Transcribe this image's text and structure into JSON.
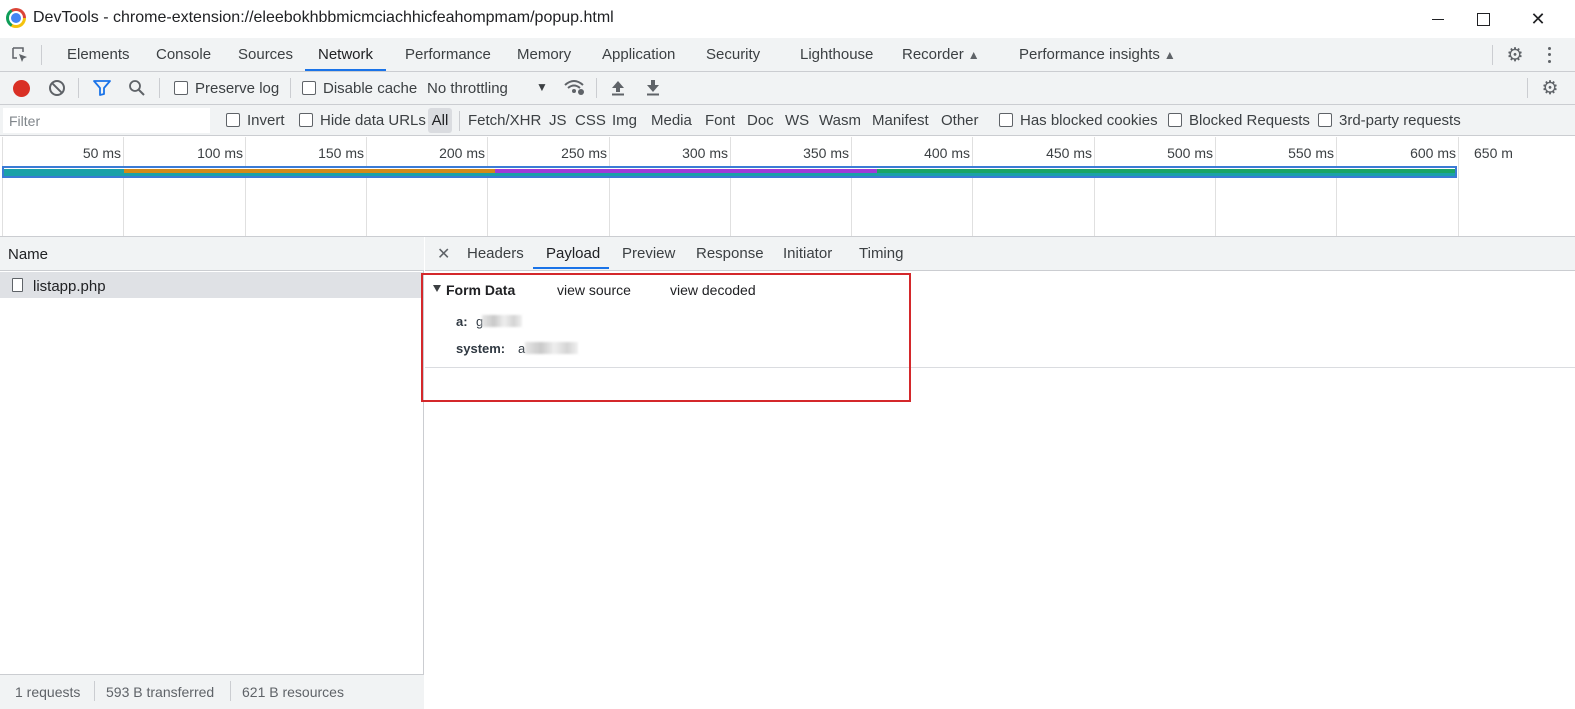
{
  "window": {
    "title": "DevTools - chrome-extension://eleebokhbbmicmciachhicfeahompmam/popup.html"
  },
  "main_tabs": [
    {
      "label": "Elements"
    },
    {
      "label": "Console"
    },
    {
      "label": "Sources"
    },
    {
      "label": "Network"
    },
    {
      "label": "Performance"
    },
    {
      "label": "Memory"
    },
    {
      "label": "Application"
    },
    {
      "label": "Security"
    },
    {
      "label": "Lighthouse"
    },
    {
      "label": "Recorder"
    },
    {
      "label": "Performance insights"
    }
  ],
  "active_main_tab": "Network",
  "toolbar": {
    "preserve_log": "Preserve log",
    "disable_cache": "Disable cache",
    "throttling": "No throttling"
  },
  "filter": {
    "placeholder": "Filter",
    "invert": "Invert",
    "hide_data_urls": "Hide data URLs",
    "types": [
      "All",
      "Fetch/XHR",
      "JS",
      "CSS",
      "Img",
      "Media",
      "Font",
      "Doc",
      "WS",
      "Wasm",
      "Manifest",
      "Other"
    ],
    "has_blocked_cookies": "Has blocked cookies",
    "blocked_requests": "Blocked Requests",
    "third_party": "3rd-party requests"
  },
  "timeline": {
    "ticks": [
      "50 ms",
      "100 ms",
      "150 ms",
      "200 ms",
      "250 ms",
      "300 ms",
      "350 ms",
      "400 ms",
      "450 ms",
      "500 ms",
      "550 ms",
      "600 ms",
      "650 m"
    ],
    "colors": {
      "frame": "#3a7bd5",
      "teal": "#1aa1a8",
      "orange": "#d28a18",
      "purple": "#a03ad8",
      "green": "#1aa566"
    }
  },
  "requests": {
    "header": "Name",
    "rows": [
      {
        "name": "listapp.php"
      }
    ]
  },
  "status": {
    "requests": "1 requests",
    "transferred": "593 B transferred",
    "resources": "621 B resources"
  },
  "details": {
    "tabs": [
      "Headers",
      "Payload",
      "Preview",
      "Response",
      "Initiator",
      "Timing"
    ],
    "active_tab": "Payload",
    "form_data": {
      "title": "Form Data",
      "view_source": "view source",
      "view_decoded": "view decoded",
      "fields": [
        {
          "key": "a:",
          "value": "g"
        },
        {
          "key": "system:",
          "value": "a"
        }
      ]
    }
  },
  "colors": {
    "accent": "#1a73e8",
    "record": "#d93025",
    "highlight_box": "#d4282b"
  }
}
